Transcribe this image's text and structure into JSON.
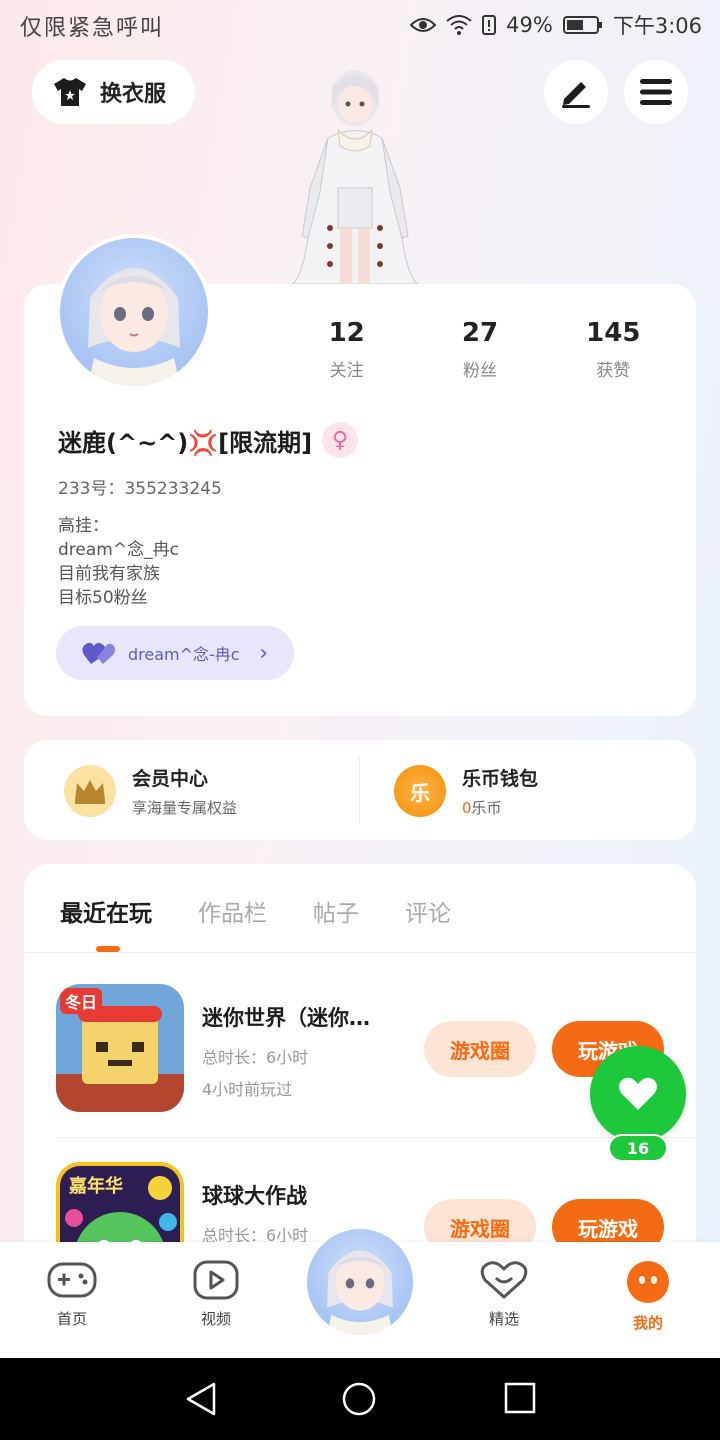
{
  "status_bar": {
    "left_text": "仅限紧急呼叫",
    "battery": "49%",
    "time": "下午3:06"
  },
  "header": {
    "outfit_label": "换衣服",
    "edit_icon": "pen-icon",
    "menu_icon": "hamburger-icon"
  },
  "profile": {
    "stats": [
      {
        "value": "12",
        "label": "关注"
      },
      {
        "value": "27",
        "label": "粉丝"
      },
      {
        "value": "145",
        "label": "获赞"
      }
    ],
    "nickname": "迷鹿(^~^)💢[限流期]",
    "gender_symbol": "♀",
    "uid": "233号：355233245",
    "bio_lines": [
      "高挂：",
      "dream^念_冉c",
      "目前我有家族",
      "目标50粉丝"
    ],
    "family_label": "dream^念-冉c"
  },
  "member": {
    "vip_title": "会员中心",
    "vip_sub": "享海量专属权益",
    "wallet_title": "乐币钱包",
    "wallet_amount": "0",
    "wallet_unit": "乐币",
    "wallet_icon_text": "乐"
  },
  "tabs": [
    "最近在玩",
    "作品栏",
    "帖子",
    "评论"
  ],
  "games": [
    {
      "name": "迷你世界（迷你…",
      "total_time": "总时长：6小时",
      "last_played": "4小时前玩过",
      "circle_label": "游戏圈",
      "play_label": "玩游戏",
      "icon_badge": "冬日"
    },
    {
      "name": "球球大作战",
      "total_time": "总时长：6小时",
      "last_played": "",
      "circle_label": "游戏圈",
      "play_label": "玩游戏",
      "icon_badge": "嘉年华"
    }
  ],
  "float_like": {
    "count": "16"
  },
  "bottom_nav": [
    {
      "label": "首页",
      "icon": "gamepad-icon"
    },
    {
      "label": "视频",
      "icon": "play-icon"
    },
    {
      "label": "精选",
      "icon": "heart-icon"
    },
    {
      "label": "我的",
      "icon": "face-icon"
    }
  ],
  "colors": {
    "accent": "#f46b14",
    "green": "#1dc93b",
    "purple": "#6158c9"
  }
}
